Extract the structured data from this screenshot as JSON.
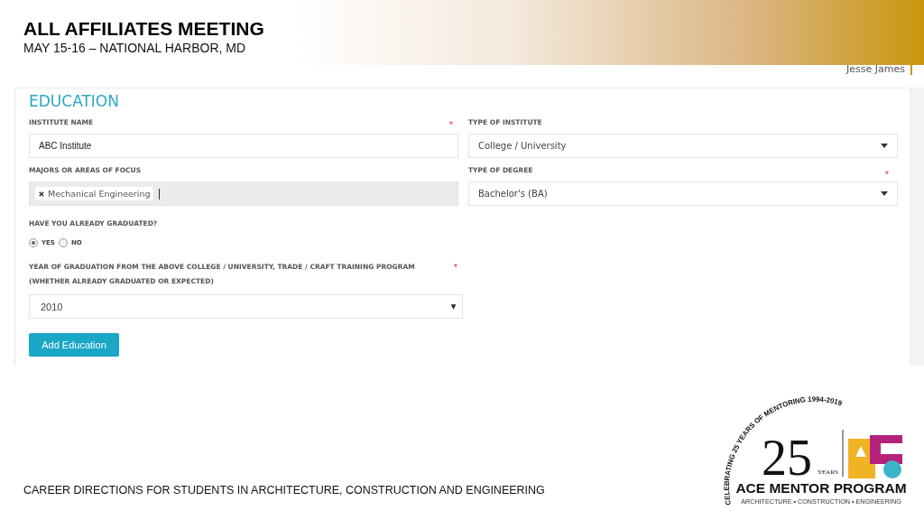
{
  "header": {
    "title": "ALL AFFILIATES MEETING",
    "subtitle": "MAY 15-16 – NATIONAL HARBOR, MD"
  },
  "screenshot": {
    "user": "Jesse James",
    "section_title": "EDUCATION",
    "fields": [
      {
        "kind": "text",
        "label": "INSTITUTE NAME",
        "required_mark": "*",
        "value": "ABC Institute"
      },
      {
        "kind": "select",
        "label": "TYPE OF INSTITUTE",
        "value": "College / University"
      },
      {
        "kind": "tags",
        "label": "MAJORS OR AREAS OF FOCUS",
        "tags": [
          "Mechanical Engineering"
        ]
      },
      {
        "kind": "select",
        "label": "TYPE OF DEGREE",
        "required_mark": "*",
        "value": "Bachelor's (BA)"
      }
    ],
    "graduated": {
      "label": "HAVE YOU ALREADY GRADUATED?",
      "options": [
        {
          "label": "YES",
          "selected": true
        },
        {
          "label": "NO",
          "selected": false
        }
      ]
    },
    "year": {
      "label": "YEAR OF GRADUATION FROM THE ABOVE COLLEGE / UNIVERSITY, TRADE / CRAFT TRAINING PROGRAM",
      "note": "(WHETHER ALREADY GRADUATED OR EXPECTED)",
      "required_mark": "*",
      "value": "2010"
    },
    "button": "Add Education"
  },
  "footer": "CAREER DIRECTIONS FOR STUDENTS IN ARCHITECTURE, CONSTRUCTION AND ENGINEERING",
  "logo": {
    "arc_text": "CELEBRATING 25 YEARS OF MENTORING 1994-2019",
    "number": "25",
    "years": "YEARS",
    "name": "ACE MENTOR PROGRAM",
    "tagline": "ARCHITECTURE • CONSTRUCTION • ENGINEERING"
  }
}
